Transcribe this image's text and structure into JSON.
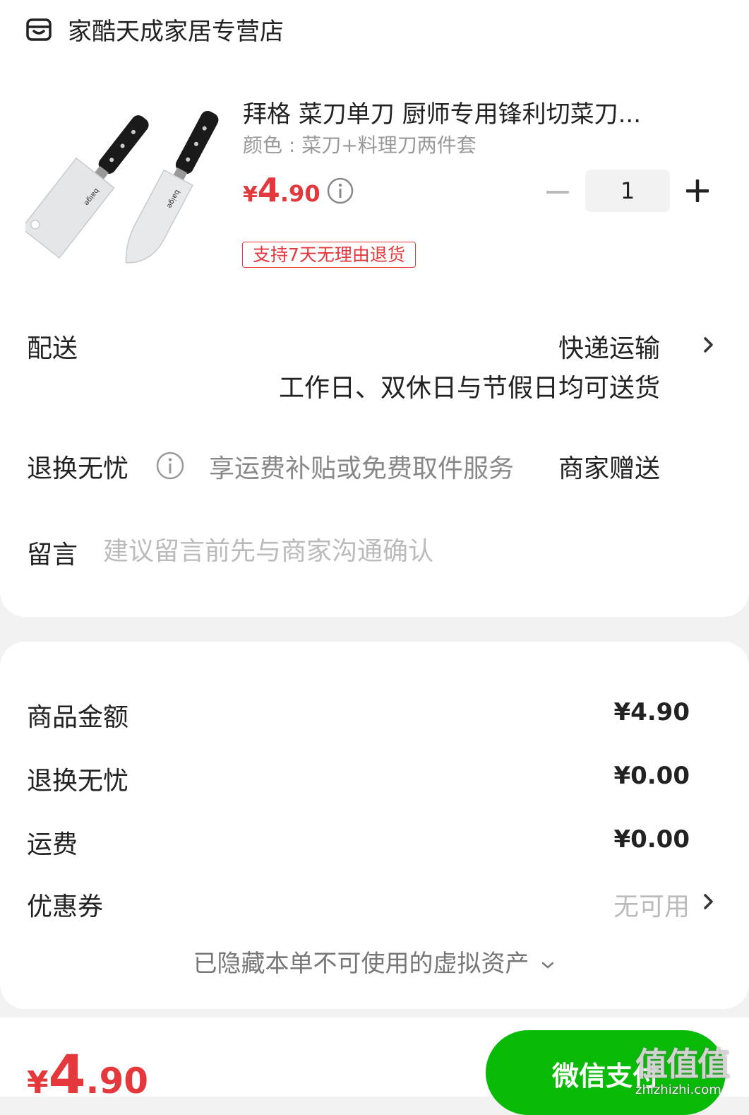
{
  "store": {
    "name": "家酷天成家居专营店",
    "icon": "store-icon"
  },
  "product": {
    "title": "拜格 菜刀单刀 厨师专用锋利切菜刀...",
    "spec": "颜色 : 菜刀+料理刀两件套",
    "price_symbol": "¥",
    "price_int": "4",
    "price_dec": ".90",
    "quantity": "1",
    "return_tag": "支持7天无理由退货",
    "image": "knife-set-image"
  },
  "delivery": {
    "label": "配送",
    "value": "快递运输",
    "sub": "工作日、双休日与节假日均可送货"
  },
  "return_service": {
    "label": "退换无忧",
    "desc": "享运费补贴或免费取件服务",
    "gift": "商家赠送"
  },
  "message": {
    "label": "留言",
    "placeholder": "建议留言前先与商家沟通确认"
  },
  "summary": {
    "goods_label": "商品金额",
    "goods_value": "¥4.90",
    "return_label": "退换无忧",
    "return_value": "¥0.00",
    "shipping_label": "运费",
    "shipping_value": "¥0.00",
    "coupon_label": "优惠券",
    "coupon_value": "无可用",
    "hidden_assets": "已隐藏本单不可使用的虚拟资产"
  },
  "footer": {
    "total_symbol": "¥",
    "total_int": "4",
    "total_dec": ".90",
    "pay_label": "微信支付"
  },
  "watermark": {
    "chars": "值值值",
    "url": "zhizhizhi.com"
  },
  "colors": {
    "price_red": "#e4393c",
    "wechat_green": "#09bb07",
    "page_bg": "#f2f2f2"
  }
}
